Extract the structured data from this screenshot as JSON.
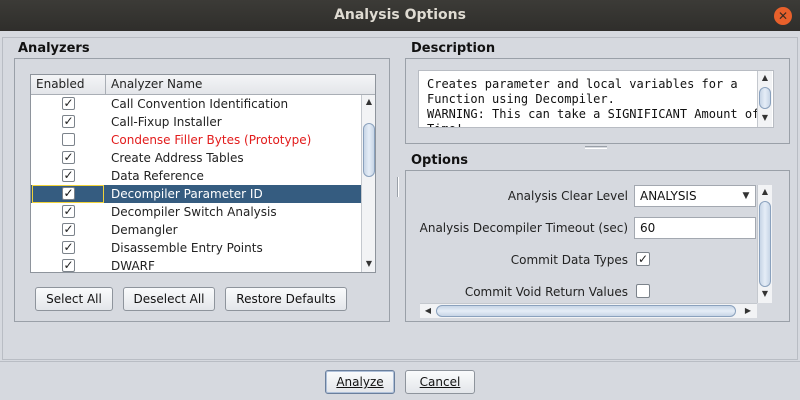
{
  "window": {
    "title": "Analysis Options",
    "close_glyph": "✕"
  },
  "analyzers": {
    "title": "Analyzers",
    "columns": {
      "enabled": "Enabled",
      "name": "Analyzer Name"
    },
    "rows": [
      {
        "name": "Call Convention Identification",
        "enabled": true
      },
      {
        "name": "Call-Fixup Installer",
        "enabled": true
      },
      {
        "name": "Condense Filler Bytes (Prototype)",
        "enabled": false,
        "warning_color": "#e21b1b"
      },
      {
        "name": "Create Address Tables",
        "enabled": true
      },
      {
        "name": "Data Reference",
        "enabled": true
      },
      {
        "name": "Decompiler Parameter ID",
        "enabled": true,
        "selected": true
      },
      {
        "name": "Decompiler Switch Analysis",
        "enabled": true
      },
      {
        "name": "Demangler",
        "enabled": true
      },
      {
        "name": "Disassemble Entry Points",
        "enabled": true
      },
      {
        "name": "DWARF",
        "enabled": true
      }
    ],
    "buttons": {
      "select_all": "Select All",
      "deselect_all": "Deselect All",
      "restore_defaults": "Restore Defaults"
    }
  },
  "description": {
    "title": "Description",
    "text": "Creates parameter and local variables for a\nFunction using Decompiler.\nWARNING: This can take a SIGNIFICANT Amount of\nTime!"
  },
  "options": {
    "title": "Options",
    "clear_level": {
      "label": "Analysis Clear Level",
      "value": "ANALYSIS"
    },
    "timeout": {
      "label": "Analysis Decompiler Timeout (sec)",
      "value": "60"
    },
    "commit_data_types": {
      "label": "Commit Data Types",
      "checked": true
    },
    "commit_void_return": {
      "label": "Commit Void Return Values",
      "checked": false
    }
  },
  "footer": {
    "analyze": "Analyze",
    "cancel": "Cancel"
  },
  "colors": {
    "selection": "#355c80",
    "title_bar": "#3c3b37",
    "close_button": "#e8602b"
  },
  "check_glyph": "✓"
}
